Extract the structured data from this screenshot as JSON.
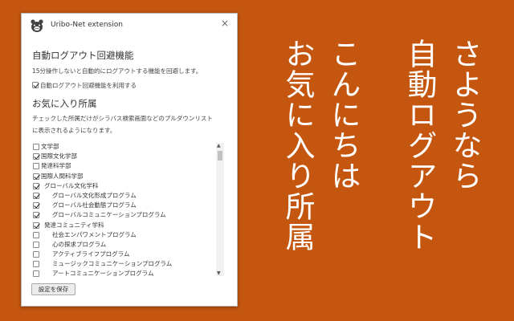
{
  "popup": {
    "title": "Uribo-Net extension",
    "close_glyph": "×",
    "auto_logout": {
      "heading": "自動ログアウト回避機能",
      "description": "15分操作しないと自動的にログアウトする機能を回避します。",
      "checkbox_label": "自動ログアウト回避機能を利用する",
      "checked": true
    },
    "favorites": {
      "heading": "お気に入り所属",
      "description_line1": "チェックした所属だけがシラバス検索画面などのプルダウンリスト",
      "description_line2": "に表示されるようになります。",
      "items": [
        {
          "label": "文学部",
          "checked": false,
          "level": 0
        },
        {
          "label": "国際文化学部",
          "checked": true,
          "level": 0
        },
        {
          "label": "発達科学部",
          "checked": false,
          "level": 0
        },
        {
          "label": "国際人間科学部",
          "checked": true,
          "level": 0
        },
        {
          "label": "グローバル文化学科",
          "checked": true,
          "level": 1
        },
        {
          "label": "グローバル文化形成プログラム",
          "checked": true,
          "level": 2
        },
        {
          "label": "グローバル社会動態プログラム",
          "checked": true,
          "level": 2
        },
        {
          "label": "グローバルコミュニケーションプログラム",
          "checked": true,
          "level": 2
        },
        {
          "label": "発達コミュニティ学科",
          "checked": true,
          "level": 1
        },
        {
          "label": "社会エンパワメントプログラム",
          "checked": false,
          "level": 2
        },
        {
          "label": "心の探求プログラム",
          "checked": false,
          "level": 2
        },
        {
          "label": "アクティブライフプログラム",
          "checked": false,
          "level": 2
        },
        {
          "label": "ミュージックコミュニケーションプログラム",
          "checked": false,
          "level": 2
        },
        {
          "label": "アートコミュニケーションプログラム",
          "checked": false,
          "level": 2
        }
      ]
    },
    "save_label": "設定を保存"
  },
  "headline_columns": [
    "さようなら",
    "自動ログアウト",
    "こんにちは",
    "お気に入り所属"
  ],
  "colors": {
    "background": "#c4560f",
    "text_on_background": "#ffffff"
  }
}
